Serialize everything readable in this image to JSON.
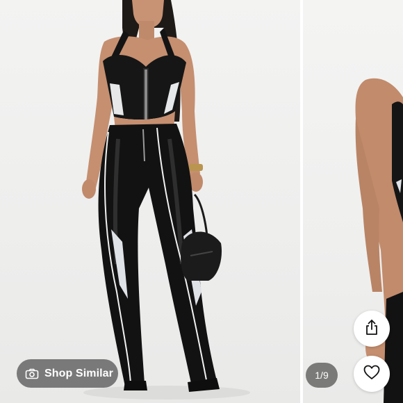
{
  "product_gallery": {
    "shop_similar_label": "Shop Similar",
    "image_counter": "1/9",
    "icons": {
      "camera": "camera-icon",
      "share": "share-icon",
      "favorite": "heart-icon"
    },
    "colors": {
      "overlay_pill": "#606060",
      "button_background": "#ffffff",
      "icon_stroke": "#111111"
    }
  }
}
